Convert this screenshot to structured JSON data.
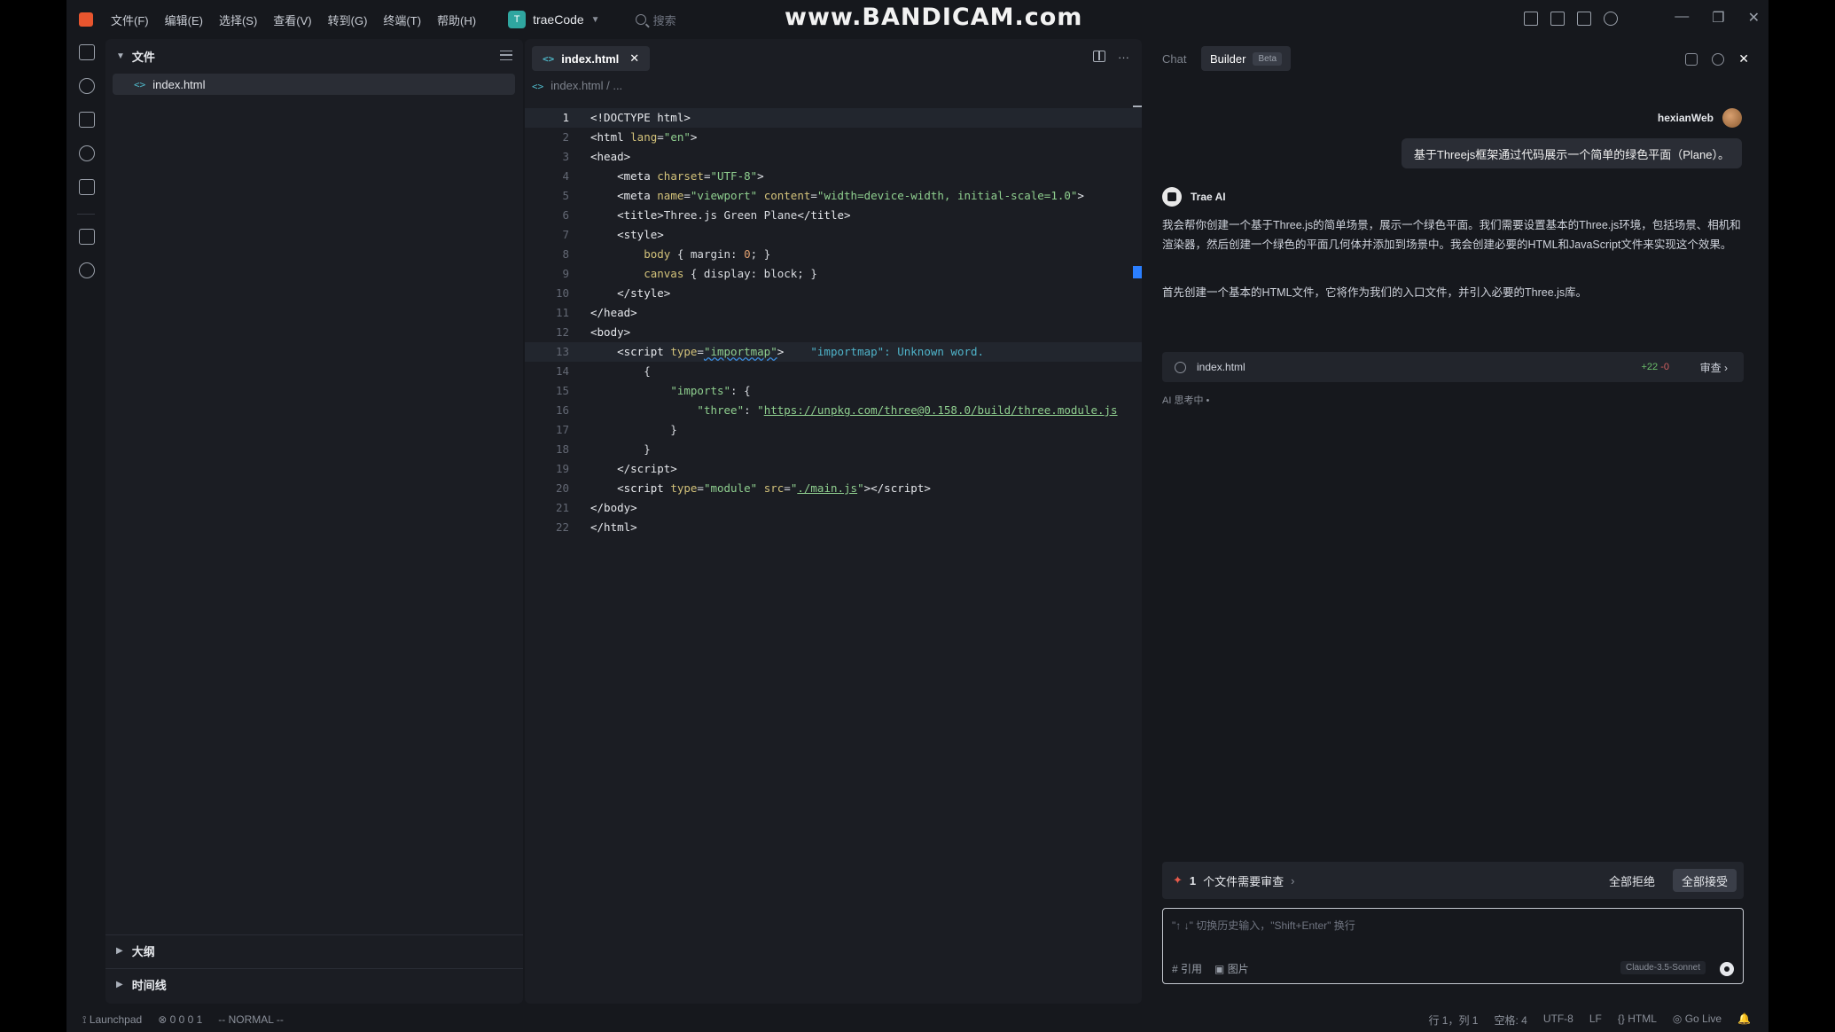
{
  "titlebar": {
    "menus": [
      "文件(F)",
      "编辑(E)",
      "选择(S)",
      "查看(V)",
      "转到(G)",
      "终端(T)",
      "帮助(H)"
    ],
    "project_initial": "T",
    "project_name": "traeCode",
    "search_placeholder": "搜索",
    "watermark": "www.BANDICAM.com"
  },
  "explorer": {
    "title": "文件",
    "file": "index.html",
    "outline": "大纲",
    "timeline": "时间线"
  },
  "editor": {
    "tab_label": "index.html",
    "breadcrumb": "index.html / ...",
    "hint": "\"importmap\": Unknown word.",
    "line_numbers": [
      "1",
      "2",
      "3",
      "4",
      "5",
      "6",
      "7",
      "8",
      "9",
      "10",
      "11",
      "12",
      "13",
      "14",
      "15",
      "16",
      "17",
      "18",
      "19",
      "20",
      "21",
      "22"
    ]
  },
  "chat": {
    "tab_chat": "Chat",
    "tab_builder": "Builder",
    "beta": "Beta",
    "user_name": "hexianWeb",
    "user_message": "基于Threejs框架通过代码展示一个简单的绿色平面（Plane）。",
    "ai_name": "Trae AI",
    "ai_para1": "我会帮你创建一个基于Three.js的简单场景，展示一个绿色平面。我们需要设置基本的Three.js环境，包括场景、相机和渲染器，然后创建一个绿色的平面几何体并添加到场景中。我会创建必要的HTML和JavaScript文件来实现这个效果。",
    "ai_para2": "首先创建一个基本的HTML文件，它将作为我们的入口文件，并引入必要的Three.js库。",
    "file_card_name": "index.html",
    "diff_add": "+22",
    "diff_del": "-0",
    "review": "审查",
    "thinking": "AI 思考中 •",
    "review_count": "1",
    "review_text": "个文件需要审查",
    "reject_all": "全部拒绝",
    "accept_all": "全部接受",
    "input_placeholder": "\"↑ ↓\" 切换历史输入，\"Shift+Enter\" 换行",
    "cite": "# 引用",
    "image": "图片",
    "model": "Claude-3.5-Sonnet"
  },
  "statusbar": {
    "launchpad": "Launchpad",
    "problems": "0  0  0  1",
    "mode": "-- NORMAL --",
    "position": "行 1，列 1",
    "spaces": "空格: 4",
    "encoding": "UTF-8",
    "eol": "LF",
    "language": "HTML",
    "golive": "Go Live"
  },
  "colors": {
    "background": "#16181d",
    "panel": "#1b1d23",
    "accent_blue": "#2b7fff",
    "brand_orange": "#e8552e"
  }
}
